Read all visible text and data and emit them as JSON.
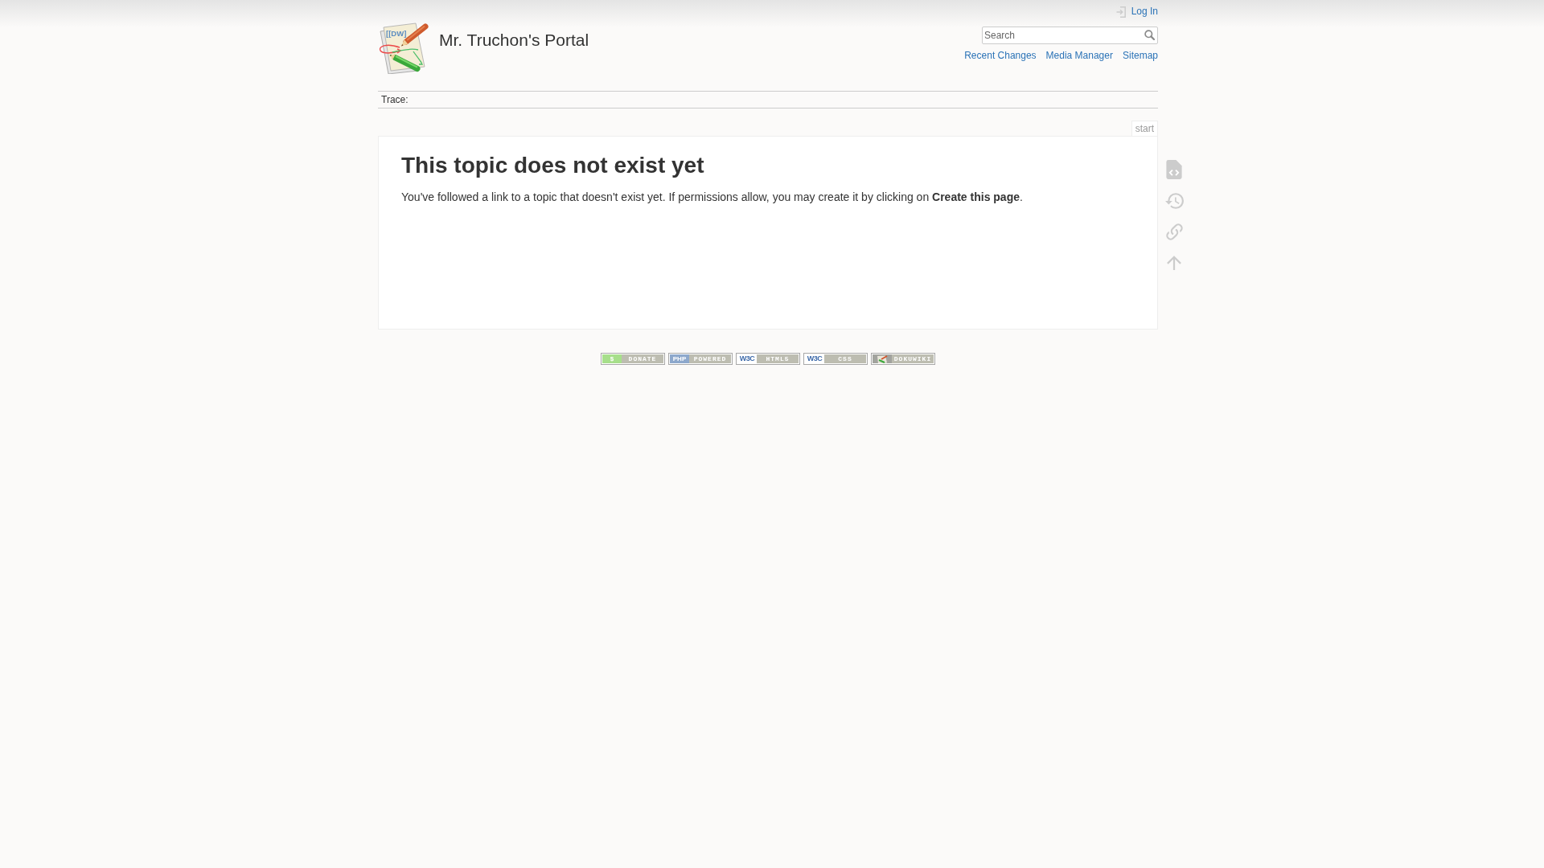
{
  "header": {
    "logo_text": "[[DW]",
    "title": "Mr. Truchon's Portal",
    "user_tools": [
      "Log In"
    ],
    "search": {
      "placeholder": "Search"
    },
    "site_tools": [
      "Recent Changes",
      "Media Manager",
      "Sitemap"
    ]
  },
  "breadcrumbs": {
    "label": "Trace:"
  },
  "page": {
    "page_id": "start",
    "heading": "This topic does not exist yet",
    "text": "You've followed a link to a topic that doesn't exist yet. If permissions allow, you may create it by clicking on **Create this page**."
  },
  "footer_badges": [
    {
      "kind": "donate",
      "symbol": "$",
      "label": "DONATE"
    },
    {
      "kind": "php",
      "symbol": "PHP",
      "label": "POWERED"
    },
    {
      "kind": "w3c",
      "symbol": "W3C",
      "label": "HTML5"
    },
    {
      "kind": "w3c",
      "symbol": "W3C",
      "label": "CSS"
    },
    {
      "kind": "dokuwiki",
      "label": "DOKUWIKI"
    }
  ]
}
